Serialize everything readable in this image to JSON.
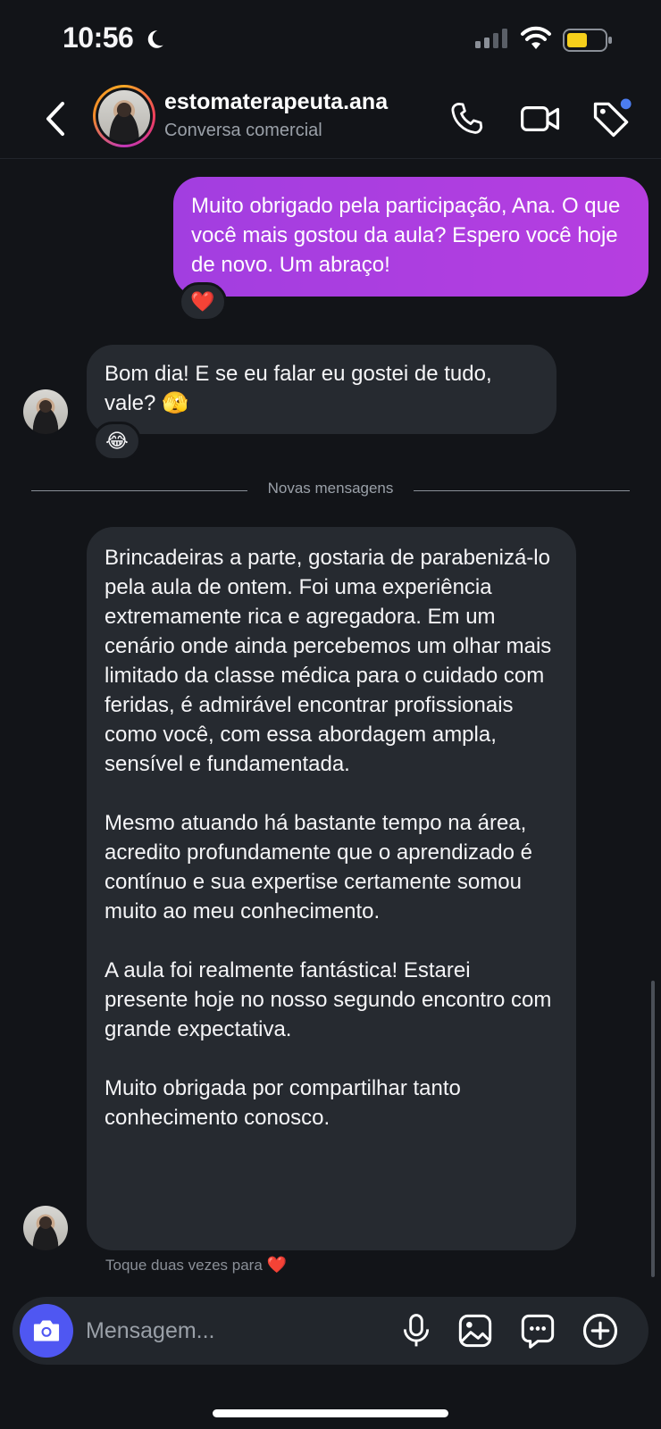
{
  "status_bar": {
    "time": "10:56"
  },
  "header": {
    "contact_name": "estomaterapeuta.ana",
    "subtitle": "Conversa comercial"
  },
  "messages": {
    "outgoing_1": "Muito obrigado pela participação, Ana. O que você mais gostou da aula? Espero você hoje de novo. Um abraço!",
    "outgoing_1_reaction": "❤️",
    "incoming_1": "Bom dia! E se eu falar eu gostei de tudo, vale? 🫣",
    "incoming_1_reaction": "😂",
    "divider_label": "Novas mensagens",
    "incoming_2": "Brincadeiras a parte, gostaria de parabenizá-lo pela aula de ontem. Foi uma experiência extremamente rica e agregadora. Em um cenário onde ainda percebemos um olhar mais limitado da classe médica para o cuidado com feridas, é admirável encontrar profissionais como você, com essa abordagem ampla, sensível e fundamentada.\n\nMesmo atuando há bastante tempo na área, acredito profundamente que o aprendizado é contínuo e sua expertise certamente somou muito ao meu conhecimento.\n\nA aula foi realmente fantástica! Estarei presente hoje no nosso segundo encontro com grande expectativa.\n\nMuito obrigada por compartilhar tanto conhecimento conosco.",
    "hint_text": "Toque duas vezes para",
    "hint_heart": "❤️"
  },
  "composer": {
    "placeholder": "Mensagem..."
  },
  "colors": {
    "background": "#121418",
    "outgoing_bubble": "#b03de0",
    "incoming_bubble": "#262a30",
    "camera_button": "#4f57f2",
    "notification_dot": "#4c7df0",
    "battery_fill": "#f6cf1b"
  },
  "icons": {
    "status": [
      "moon-icon",
      "signal-icon",
      "wifi-icon",
      "battery-icon"
    ],
    "header": [
      "back-chevron-icon",
      "phone-icon",
      "video-camera-icon",
      "tag-icon"
    ],
    "composer": [
      "camera-icon",
      "microphone-icon",
      "gallery-icon",
      "sticker-message-icon",
      "plus-circle-icon"
    ]
  }
}
